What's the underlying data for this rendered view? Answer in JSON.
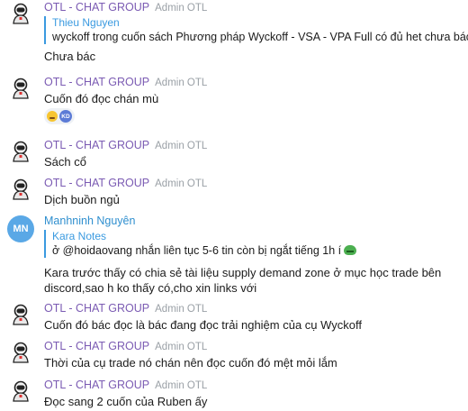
{
  "messages": [
    {
      "sender": "OTL - CHAT GROUP",
      "role": "Admin OTL",
      "reply_to": {
        "name": "Thieu Nguyen",
        "text": "wyckoff trong cuốn sách Phương pháp Wyckoff - VSA - VPA Full có đủ het chưa bác"
      },
      "text": "Chưa bác"
    },
    {
      "sender": "OTL - CHAT GROUP",
      "role": "Admin OTL",
      "text": "Cuốn đó đọc chán mù",
      "reactions": {
        "emoji": "laughing-face",
        "badge": "KD"
      }
    },
    {
      "sender": "OTL - CHAT GROUP",
      "role": "Admin OTL",
      "text": "Sách cổ"
    },
    {
      "sender": "OTL - CHAT GROUP",
      "role": "Admin OTL",
      "text": "Dịch buồn ngủ"
    },
    {
      "sender": "Manhninh Nguyên",
      "avatar_initials": "MN",
      "reply_to": {
        "name": "Kara Notes",
        "text": "ở @hoidaovang nhắn liên tục 5-6 tin còn bị ngắt tiếng 1h í"
      },
      "text": "Kara trước thấy có chia sẻ tài liệu supply demand zone ở mục học trade bên discord,sao h ko thấy có,cho xin links với"
    },
    {
      "sender": "OTL - CHAT GROUP",
      "role": "Admin OTL",
      "text": "Cuốn đó bác đọc là bác đang đọc trải nghiệm của cụ Wyckoff"
    },
    {
      "sender": "OTL - CHAT GROUP",
      "role": "Admin OTL",
      "text": "Thời của cụ trade nó chán nên đọc cuốn đó mệt mỏi lắm"
    },
    {
      "sender": "OTL - CHAT GROUP",
      "role": "Admin OTL",
      "text": "Đọc sang 2 cuốn của Ruben ấy"
    }
  ]
}
